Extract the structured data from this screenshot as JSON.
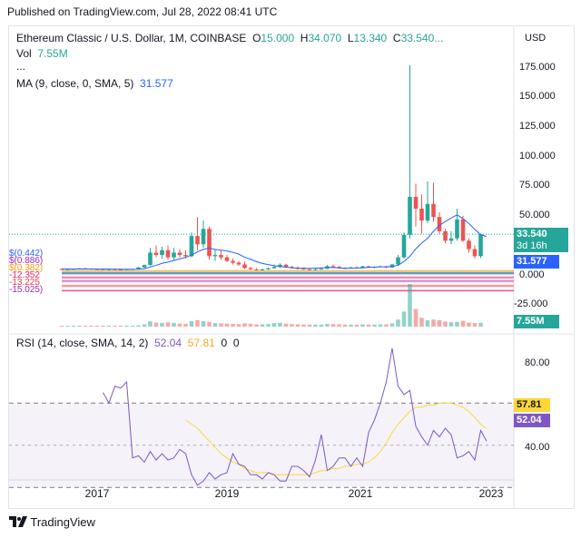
{
  "header": {
    "published": "Published on TradingView.com, Jul 28, 2022 08:41 UTC"
  },
  "main_legend": {
    "symbol": "Ethereum Classic / U.S. Dollar, 1M, COINBASE",
    "o_label": "O",
    "o_value": "15.000",
    "h_label": "H",
    "h_value": "34.070",
    "l_label": "L",
    "l_value": "13.340",
    "c_label": "C",
    "c_value": "33.540...",
    "vol_label": "Vol",
    "vol_value": "7.55M",
    "dots": "...",
    "ma_label": "MA (9, close, 0, SMA, 5)",
    "ma_value": "31.577"
  },
  "price_axis": {
    "currency": "USD",
    "ticks": [
      "175.000",
      "150.000",
      "125.000",
      "100.000",
      "75.000",
      "50.000",
      "0.000",
      "-25.000"
    ],
    "last_price": "33.540",
    "countdown": "3d 16h",
    "ma_tag": "31.577",
    "volume_tag": "7.55M"
  },
  "rsi_legend": {
    "label": "RSI (14, close, SMA, 14, 2)",
    "rsi_value": "52.04",
    "sma_value": "57.81",
    "extra1": "0",
    "extra2": "0"
  },
  "rsi_axis": {
    "ticks": [
      "80.00",
      "40.00"
    ],
    "sma_tag": "57.81",
    "rsi_tag": "52.04"
  },
  "time_axis": {
    "ticks": [
      "2017",
      "2019",
      "2021",
      "2023"
    ]
  },
  "footer": {
    "brand": "TradingView"
  },
  "colors": {
    "up": "#26a69a",
    "down": "#ef5350",
    "ma": "#2962ff",
    "rsi": "#7e57c2",
    "rsi_sma": "#fdd835",
    "volume_tag": "#26a69a",
    "ma_tag": "#2962ff"
  },
  "chart_data": {
    "type": "candlestick",
    "y_axis_range": [
      -35,
      180
    ],
    "candles": [
      {
        "o": 4.2,
        "h": 4.5,
        "l": 3.5,
        "c": 4.0
      },
      {
        "o": 4.0,
        "h": 4.4,
        "l": 3.7,
        "c": 4.1
      },
      {
        "o": 4.1,
        "h": 4.6,
        "l": 3.8,
        "c": 4.3
      },
      {
        "o": 4.3,
        "h": 5.0,
        "l": 4.0,
        "c": 4.8
      },
      {
        "o": 4.8,
        "h": 5.2,
        "l": 4.2,
        "c": 4.5
      },
      {
        "o": 4.5,
        "h": 4.8,
        "l": 3.9,
        "c": 4.2
      },
      {
        "o": 4.2,
        "h": 4.5,
        "l": 3.8,
        "c": 4.1
      },
      {
        "o": 4.1,
        "h": 4.4,
        "l": 3.6,
        "c": 3.9
      },
      {
        "o": 3.9,
        "h": 4.3,
        "l": 3.5,
        "c": 4.0
      },
      {
        "o": 4.0,
        "h": 4.3,
        "l": 3.6,
        "c": 3.8
      },
      {
        "o": 3.8,
        "h": 4.1,
        "l": 3.4,
        "c": 3.7
      },
      {
        "o": 3.7,
        "h": 4.2,
        "l": 3.5,
        "c": 4.0
      },
      {
        "o": 4.0,
        "h": 4.4,
        "l": 3.7,
        "c": 4.2
      },
      {
        "o": 4.2,
        "h": 6.0,
        "l": 4.0,
        "c": 5.5
      },
      {
        "o": 5.5,
        "h": 8.0,
        "l": 5.0,
        "c": 7.5
      },
      {
        "o": 7.5,
        "h": 22.0,
        "l": 7.0,
        "c": 18.0
      },
      {
        "o": 18.0,
        "h": 24.0,
        "l": 14.0,
        "c": 16.0
      },
      {
        "o": 16.0,
        "h": 23.0,
        "l": 13.0,
        "c": 20.0
      },
      {
        "o": 20.0,
        "h": 24.0,
        "l": 12.0,
        "c": 14.0
      },
      {
        "o": 14.0,
        "h": 22.0,
        "l": 12.0,
        "c": 18.0
      },
      {
        "o": 18.0,
        "h": 21.0,
        "l": 14.0,
        "c": 16.0
      },
      {
        "o": 16.0,
        "h": 20.0,
        "l": 13.0,
        "c": 15.0
      },
      {
        "o": 15.0,
        "h": 35.0,
        "l": 14.0,
        "c": 32.0
      },
      {
        "o": 32.0,
        "h": 48.0,
        "l": 20.0,
        "c": 25.0
      },
      {
        "o": 25.0,
        "h": 45.0,
        "l": 22.0,
        "c": 38.0
      },
      {
        "o": 38.0,
        "h": 40.0,
        "l": 12.0,
        "c": 15.0
      },
      {
        "o": 15.0,
        "h": 21.0,
        "l": 11.0,
        "c": 16.0
      },
      {
        "o": 16.0,
        "h": 20.0,
        "l": 12.0,
        "c": 14.0
      },
      {
        "o": 14.0,
        "h": 16.0,
        "l": 10.0,
        "c": 11.0
      },
      {
        "o": 11.0,
        "h": 13.0,
        "l": 8.0,
        "c": 9.5
      },
      {
        "o": 9.5,
        "h": 11.0,
        "l": 7.0,
        "c": 8.0
      },
      {
        "o": 8.0,
        "h": 10.5,
        "l": 4.0,
        "c": 5.0
      },
      {
        "o": 5.0,
        "h": 6.0,
        "l": 3.5,
        "c": 4.0
      },
      {
        "o": 4.0,
        "h": 5.0,
        "l": 3.0,
        "c": 3.5
      },
      {
        "o": 3.5,
        "h": 4.5,
        "l": 3.0,
        "c": 3.9
      },
      {
        "o": 3.9,
        "h": 5.5,
        "l": 3.5,
        "c": 4.8
      },
      {
        "o": 4.8,
        "h": 8.0,
        "l": 4.5,
        "c": 6.0
      },
      {
        "o": 6.0,
        "h": 9.0,
        "l": 5.0,
        "c": 7.8
      },
      {
        "o": 7.8,
        "h": 8.5,
        "l": 5.0,
        "c": 6.0
      },
      {
        "o": 6.0,
        "h": 7.0,
        "l": 4.5,
        "c": 5.0
      },
      {
        "o": 5.0,
        "h": 6.5,
        "l": 4.0,
        "c": 4.5
      },
      {
        "o": 4.5,
        "h": 5.5,
        "l": 3.5,
        "c": 4.0
      },
      {
        "o": 4.0,
        "h": 4.8,
        "l": 3.3,
        "c": 3.8
      },
      {
        "o": 3.8,
        "h": 4.6,
        "l": 3.2,
        "c": 4.1
      },
      {
        "o": 4.1,
        "h": 5.0,
        "l": 3.8,
        "c": 4.4
      },
      {
        "o": 4.4,
        "h": 7.5,
        "l": 4.2,
        "c": 6.5
      },
      {
        "o": 6.5,
        "h": 8.0,
        "l": 5.5,
        "c": 6.0
      },
      {
        "o": 6.0,
        "h": 6.8,
        "l": 4.5,
        "c": 5.0
      },
      {
        "o": 5.0,
        "h": 5.6,
        "l": 4.2,
        "c": 4.8
      },
      {
        "o": 4.8,
        "h": 6.0,
        "l": 4.5,
        "c": 5.5
      },
      {
        "o": 5.5,
        "h": 6.5,
        "l": 4.8,
        "c": 5.2
      },
      {
        "o": 5.2,
        "h": 6.8,
        "l": 5.0,
        "c": 6.5
      },
      {
        "o": 6.5,
        "h": 7.0,
        "l": 5.5,
        "c": 5.7
      },
      {
        "o": 5.7,
        "h": 6.5,
        "l": 5.0,
        "c": 6.0
      },
      {
        "o": 6.0,
        "h": 7.0,
        "l": 5.5,
        "c": 6.5
      },
      {
        "o": 6.5,
        "h": 6.8,
        "l": 5.0,
        "c": 5.5
      },
      {
        "o": 5.5,
        "h": 8.5,
        "l": 5.2,
        "c": 8.0
      },
      {
        "o": 8.0,
        "h": 16.0,
        "l": 7.0,
        "c": 14.0
      },
      {
        "o": 14.0,
        "h": 35.0,
        "l": 13.0,
        "c": 33.0
      },
      {
        "o": 33.0,
        "h": 176.0,
        "l": 30.0,
        "c": 65.0
      },
      {
        "o": 65.0,
        "h": 76.0,
        "l": 40.0,
        "c": 55.0
      },
      {
        "o": 55.0,
        "h": 67.0,
        "l": 34.0,
        "c": 45.0
      },
      {
        "o": 45.0,
        "h": 78.0,
        "l": 43.0,
        "c": 59.0
      },
      {
        "o": 59.0,
        "h": 77.0,
        "l": 44.0,
        "c": 48.0
      },
      {
        "o": 48.0,
        "h": 52.0,
        "l": 34.0,
        "c": 36.0
      },
      {
        "o": 36.0,
        "h": 38.0,
        "l": 26.0,
        "c": 28.0
      },
      {
        "o": 28.0,
        "h": 36.0,
        "l": 25.0,
        "c": 30.0
      },
      {
        "o": 30.0,
        "h": 55.0,
        "l": 28.0,
        "c": 46.0
      },
      {
        "o": 46.0,
        "h": 49.0,
        "l": 27.0,
        "c": 28.0
      },
      {
        "o": 28.0,
        "h": 30.0,
        "l": 18.0,
        "c": 21.0
      },
      {
        "o": 21.0,
        "h": 24.0,
        "l": 13.0,
        "c": 15.0
      },
      {
        "o": 15.0,
        "h": 34.07,
        "l": 13.34,
        "c": 33.54
      }
    ],
    "ma_line": [
      4.3,
      4.2,
      4.2,
      4.2,
      4.2,
      4.2,
      4.2,
      4.2,
      4.1,
      4.1,
      4.0,
      4.0,
      4.0,
      4.1,
      4.4,
      5.9,
      7.3,
      9.0,
      10.0,
      11.4,
      12.8,
      14.0,
      15.9,
      18.6,
      20.7,
      21.9,
      20.6,
      20.1,
      19.4,
      18.2,
      16.7,
      14.1,
      12.4,
      10.4,
      8.9,
      7.9,
      7.0,
      6.3,
      5.7,
      5.3,
      5.0,
      4.8,
      4.8,
      4.9,
      5.2,
      5.4,
      5.4,
      5.1,
      4.9,
      4.9,
      4.9,
      5.2,
      5.5,
      5.7,
      6.0,
      6.0,
      6.4,
      7.3,
      10.5,
      14.9,
      21.2,
      26.0,
      30.1,
      36.0,
      40.9,
      44.2,
      47.1,
      49.8,
      46.6,
      42.6,
      37.5,
      33.2,
      31.6
    ],
    "volume": [
      0.3,
      0.2,
      0.2,
      0.3,
      0.2,
      0.2,
      0.2,
      0.2,
      0.2,
      0.2,
      0.2,
      0.2,
      0.2,
      0.5,
      0.9,
      2.1,
      1.6,
      1.5,
      1.7,
      1.5,
      1.2,
      1.1,
      2.2,
      2.6,
      2.2,
      1.9,
      1.4,
      1.3,
      1.2,
      1.1,
      1.0,
      1.3,
      1.1,
      0.9,
      0.9,
      1.0,
      1.4,
      1.5,
      1.2,
      1.0,
      0.9,
      0.8,
      0.8,
      0.8,
      0.8,
      1.1,
      1.0,
      0.9,
      0.8,
      0.8,
      0.8,
      0.9,
      0.8,
      0.8,
      0.9,
      0.9,
      1.3,
      2.8,
      6.0,
      17.0,
      7.0,
      3.5,
      2.5,
      2.8,
      2.6,
      2.0,
      1.8,
      1.9,
      2.3,
      1.6,
      1.4,
      1.5
    ],
    "rsi": [
      75,
      70,
      78,
      77,
      80,
      44,
      45,
      42,
      47,
      43,
      46,
      43,
      44,
      48,
      46,
      36,
      31,
      33,
      37,
      34,
      36,
      37,
      46,
      41,
      40,
      36,
      36,
      34,
      37,
      36,
      33,
      33,
      40,
      40,
      38,
      35,
      43,
      55,
      38,
      40,
      44,
      44,
      40,
      44,
      40,
      56,
      62,
      70,
      80,
      96,
      78,
      74,
      76,
      59,
      54,
      50,
      57,
      54,
      58,
      55,
      44,
      45,
      47,
      43,
      57,
      52
    ],
    "rsi_sma": [
      null,
      null,
      null,
      null,
      null,
      null,
      null,
      null,
      null,
      null,
      null,
      null,
      null,
      null,
      62,
      60,
      58,
      55,
      52,
      49,
      46,
      44,
      42,
      41,
      39,
      38,
      37,
      37,
      37,
      36,
      36,
      36,
      36,
      36,
      36,
      36,
      37,
      38,
      38,
      39,
      39,
      40,
      40,
      41,
      41,
      42,
      44,
      47,
      51,
      56,
      60,
      63,
      66,
      68,
      68,
      69,
      69,
      70,
      70,
      70,
      69,
      68,
      66,
      63,
      60,
      57.81
    ]
  }
}
